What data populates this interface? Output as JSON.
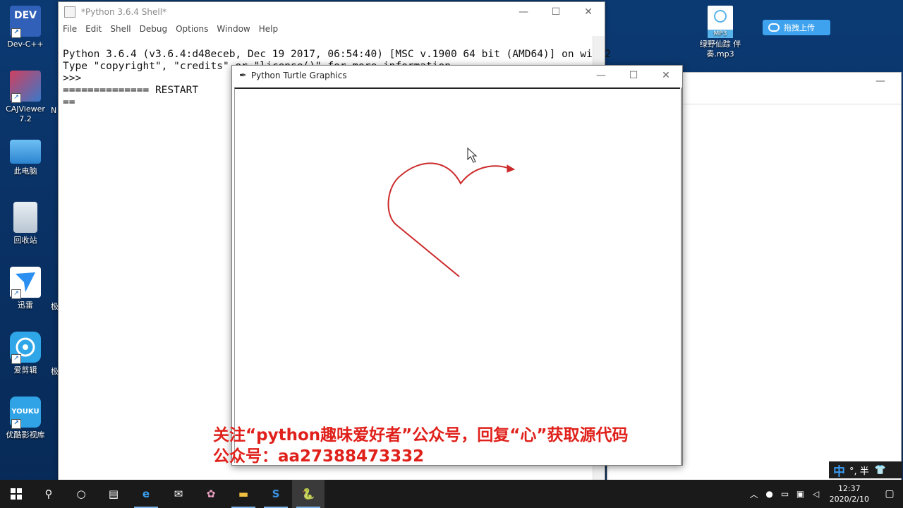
{
  "desktop": {
    "icons": [
      {
        "label": "Dev-C++",
        "glyph_text": "DEV"
      },
      {
        "label": "CAJViewer 7.2"
      },
      {
        "label": "此电脑"
      },
      {
        "label": "回收站"
      },
      {
        "label": "迅雷"
      },
      {
        "label": "爱剪辑"
      },
      {
        "label": "优酷影视库",
        "glyph_text": "YOUKU"
      }
    ],
    "partial_labels": [
      "N",
      "极",
      "极"
    ],
    "mp3_file": {
      "label": "绿野仙踪 伴奏.mp3",
      "tag": "MP3"
    },
    "upload_button": "拖拽上传"
  },
  "shell_window": {
    "title": "*Python 3.6.4 Shell*",
    "menu": [
      "File",
      "Edit",
      "Shell",
      "Debug",
      "Options",
      "Window",
      "Help"
    ],
    "lines": [
      "Python 3.6.4 (v3.6.4:d48eceb, Dec 19 2017, 06:54:40) [MSC v.1900 64 bit (AMD64)] on win32",
      "Type \"copyright\", \"credits\" or \"license()\" for more information.",
      ">>>",
      "============== RESTART",
      "=="
    ],
    "controls": {
      "minimize": "—",
      "maximize": "☐",
      "close": "✕"
    }
  },
  "turtle_window": {
    "title": "Python Turtle Graphics",
    "controls": {
      "minimize": "—",
      "maximize": "☐",
      "close": "✕"
    },
    "stroke_color": "#cc2b2b"
  },
  "caption": {
    "line1": "关注“python趣味爱好者”公众号，回复“心”获取源代码",
    "line2": "公众号：aa27388473332"
  },
  "ime": {
    "mode": "中",
    "punct": "°, 半"
  },
  "taskbar": {
    "apps": [
      "start-icon",
      "search-icon",
      "cortana-icon",
      "task-view-icon",
      "edge-icon",
      "mail-icon",
      "paint-icon",
      "file-explorer-icon",
      "sogou-icon",
      "python-icon"
    ],
    "time": "12:37",
    "date": "2020/2/10"
  }
}
